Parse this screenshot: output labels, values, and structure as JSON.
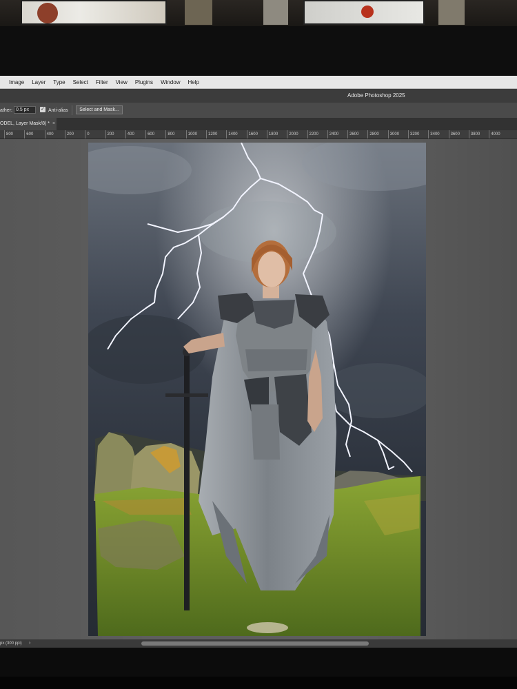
{
  "menu": {
    "items": [
      "Image",
      "Layer",
      "Type",
      "Select",
      "Filter",
      "View",
      "Plugins",
      "Window",
      "Help"
    ]
  },
  "titlebar": {
    "app_title": "Adobe Photoshop 2025"
  },
  "options": {
    "feather_label": "ather:",
    "feather_value": "0.5 px",
    "antialias_checked": true,
    "antialias_label": "Anti-alias",
    "select_mask_label": "Select and Mask..."
  },
  "document": {
    "tab_label": "ODEL, Layer Mask/8) *",
    "close_glyph": "×"
  },
  "ruler": {
    "labels": [
      "800",
      "600",
      "400",
      "200",
      "0",
      "200",
      "400",
      "600",
      "800",
      "1000",
      "1200",
      "1400",
      "1600",
      "1800",
      "2000",
      "2200",
      "2400",
      "2600",
      "2800",
      "3000",
      "3200",
      "3400",
      "3600",
      "3800",
      "4000"
    ]
  },
  "status": {
    "zoom_text": "px (300 ppi)",
    "chevron": "›"
  },
  "colors": {
    "menubar_bg": "#e6e6e6",
    "panel_bg": "#4a4a4a",
    "workspace_bg": "#5e5e5e",
    "sky": "#3b4350",
    "grass": "#6f8a2a",
    "armor": "#8a8f95"
  }
}
